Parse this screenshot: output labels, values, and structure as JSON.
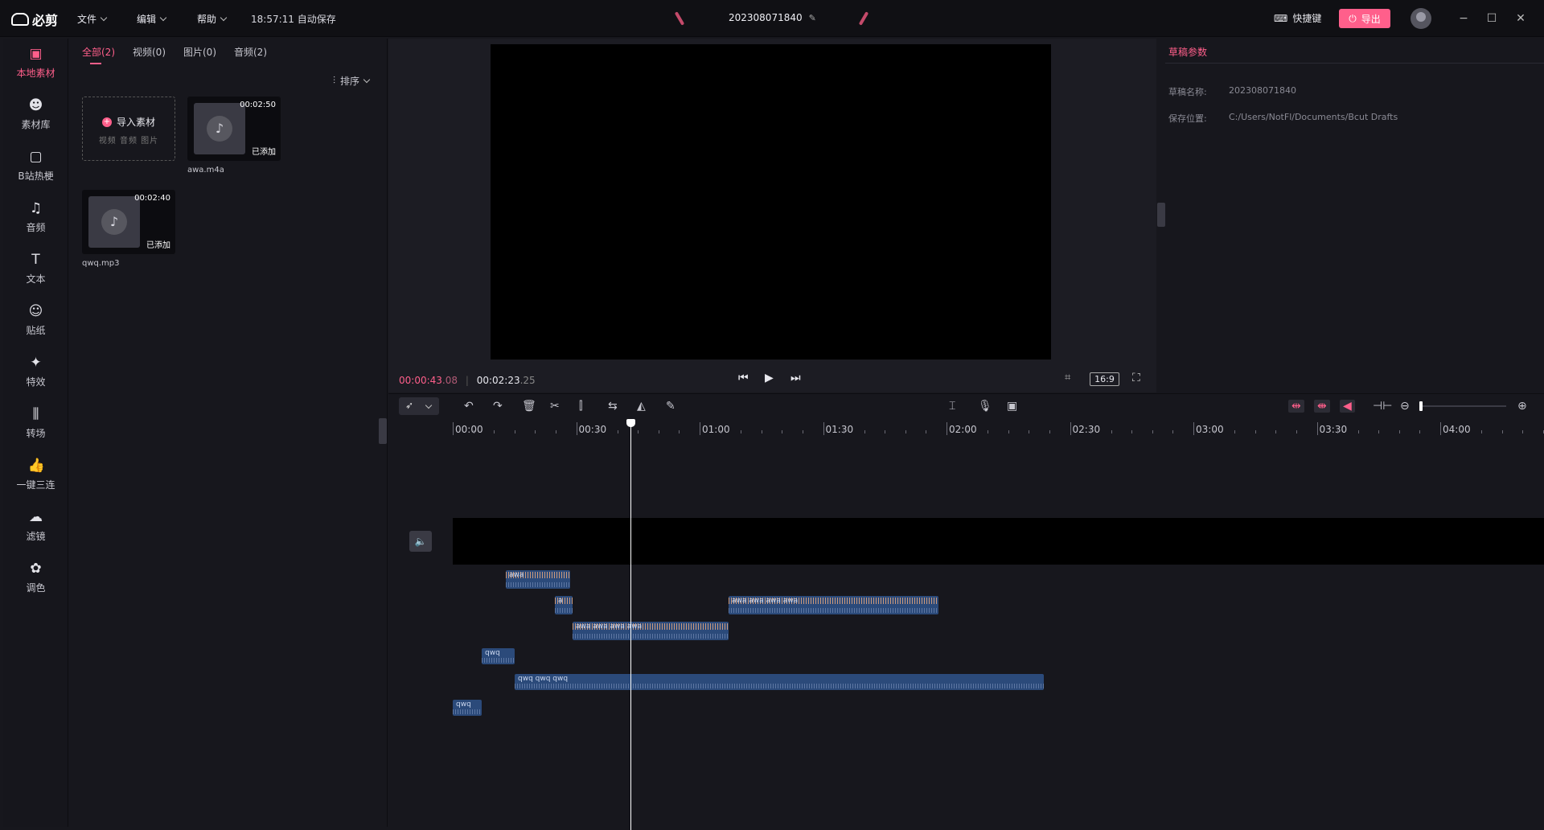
{
  "app": {
    "logo": "必剪",
    "menus": [
      "文件",
      "编辑",
      "帮助"
    ],
    "autosave": "18:57:11 自动保存",
    "project_name": "202308071840",
    "shortcut_label": "快捷键",
    "export_label": "导出"
  },
  "rail": {
    "items": [
      {
        "label": "本地素材",
        "icon": "folder-icon"
      },
      {
        "label": "素材库",
        "icon": "bilibili-icon"
      },
      {
        "label": "B站热梗",
        "icon": "tv-icon"
      },
      {
        "label": "音频",
        "icon": "music-icon"
      },
      {
        "label": "文本",
        "icon": "text-icon"
      },
      {
        "label": "贴纸",
        "icon": "sticker-icon"
      },
      {
        "label": "特效",
        "icon": "effect-icon"
      },
      {
        "label": "转场",
        "icon": "transition-icon"
      },
      {
        "label": "一键三连",
        "icon": "thumb-icon"
      },
      {
        "label": "滤镜",
        "icon": "filter-icon"
      },
      {
        "label": "调色",
        "icon": "palette-icon"
      }
    ]
  },
  "media": {
    "tabs": [
      "全部(2)",
      "视频(0)",
      "图片(0)",
      "音频(2)"
    ],
    "sort_label": "排序",
    "import_label": "导入素材",
    "import_sub": "视频 音频 图片",
    "files": [
      {
        "name": "awa.m4a",
        "duration": "00:02:50",
        "status": "已添加"
      },
      {
        "name": "qwq.mp3",
        "duration": "00:02:40",
        "status": "已添加"
      }
    ]
  },
  "preview": {
    "current_time": "00:00:43",
    "current_frames": ".08",
    "total_time": "00:02:23",
    "total_frames": ".25",
    "ratio": "16:9"
  },
  "props": {
    "title": "草稿参数",
    "name_key": "草稿名称:",
    "name_val": "202308071840",
    "path_key": "保存位置:",
    "path_val": "C:/Users/NotFl/Documents/Bcut Drafts"
  },
  "timeline": {
    "ruler": [
      "00:00",
      "00:30",
      "01:00",
      "01:30",
      "02:00",
      "02:30",
      "03:00",
      "03:30",
      "04:00"
    ],
    "clips": [
      {
        "label": "awa"
      },
      {
        "label": "a"
      },
      {
        "label": "awa   awa   awa   awa"
      },
      {
        "label": "awa   awa   awa   awa"
      },
      {
        "label": "qwq"
      },
      {
        "label": "qwq          qwq                                                                                  qwq"
      },
      {
        "label": "qwq"
      }
    ]
  }
}
